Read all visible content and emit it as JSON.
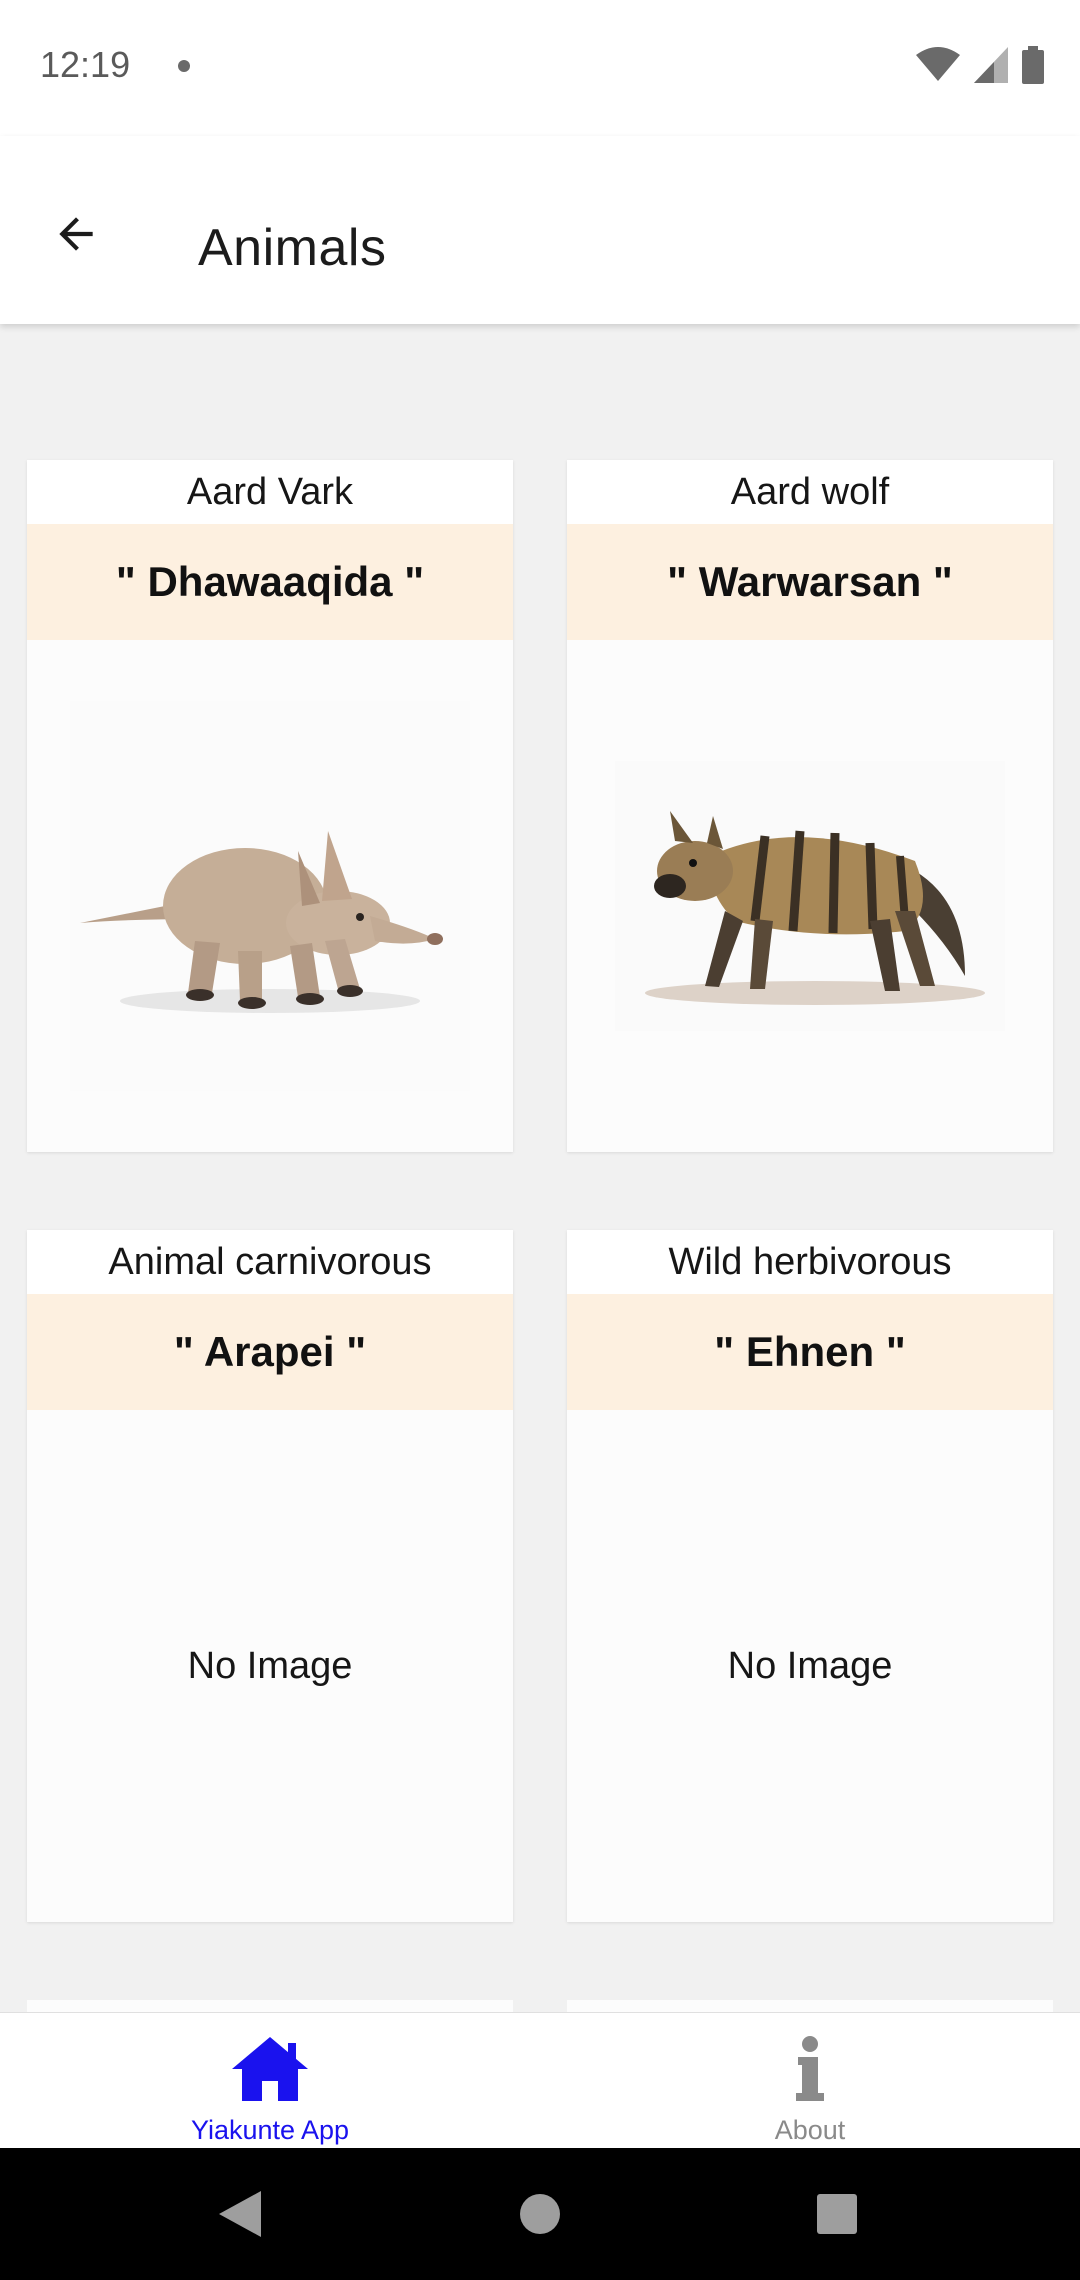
{
  "status_bar": {
    "time": "12:19",
    "icons": [
      "notification-dot-icon",
      "wifi-icon",
      "signal-icon",
      "battery-icon"
    ]
  },
  "app_bar": {
    "title": "Animals",
    "back_icon": "arrow-back-icon"
  },
  "cards": [
    {
      "english": "Aard Vark",
      "local": "\" Dhawaaqida \"",
      "image": "aardvark-image",
      "image_text": ""
    },
    {
      "english": "Aard wolf",
      "local": "\" Warwarsan \"",
      "image": "aardwolf-image",
      "image_text": ""
    },
    {
      "english": "Animal carnivorous",
      "local": "\" Arapei \"",
      "image": "",
      "image_text": "No Image"
    },
    {
      "english": "Wild herbivorous",
      "local": "\" Ehnen \"",
      "image": "",
      "image_text": "No Image"
    }
  ],
  "bottom_nav": {
    "items": [
      {
        "label": "Yiakunte App",
        "icon": "home-icon",
        "active": true
      },
      {
        "label": "About",
        "icon": "info-icon",
        "active": false
      }
    ],
    "colors": {
      "active": "#1a12ee",
      "inactive": "#8a8a8a"
    }
  },
  "colors": {
    "background": "#f1f1f1",
    "card_header_accent": "#fdf0e0"
  },
  "system_nav": {
    "icons": [
      "nav-back-icon",
      "nav-home-icon",
      "nav-recents-icon"
    ]
  }
}
